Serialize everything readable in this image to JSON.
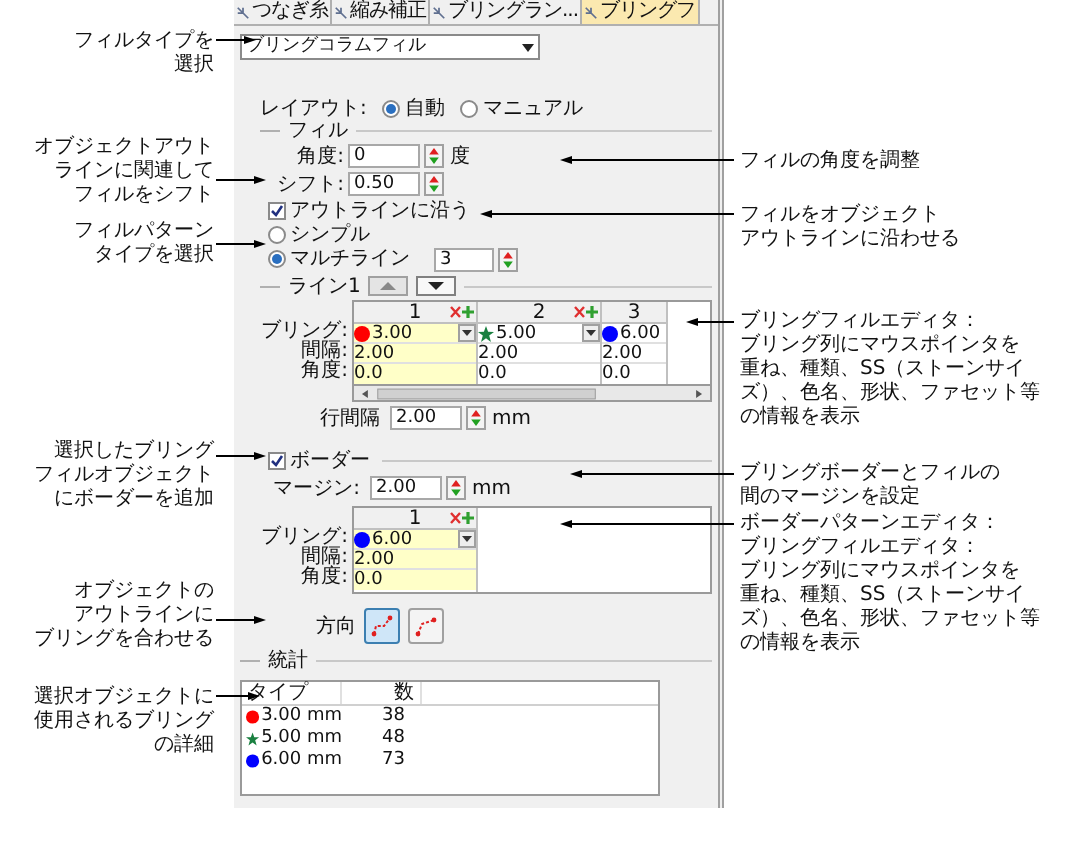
{
  "tabs": [
    {
      "label": "つなぎ糸",
      "selected": false
    },
    {
      "label": "縮み補正",
      "selected": false
    },
    {
      "label": "ブリングラン...",
      "selected": false
    },
    {
      "label": "ブリングフ",
      "selected": true
    }
  ],
  "fill_type": {
    "value": "ブリングコラムフィル"
  },
  "layout": {
    "label": "レイアウト:",
    "options": [
      {
        "label": "自動",
        "selected": true
      },
      {
        "label": "マニュアル",
        "selected": false
      }
    ]
  },
  "fill": {
    "title": "フィル",
    "angle": {
      "label": "角度:",
      "value": "0",
      "unit": "度"
    },
    "shift": {
      "label": "シフト:",
      "value": "0.50"
    },
    "follow_outline": {
      "label": "アウトラインに沿う",
      "checked": true
    },
    "pattern": [
      {
        "label": "シンプル",
        "selected": false
      },
      {
        "label": "マルチライン",
        "selected": true
      }
    ],
    "line_count": "3"
  },
  "line_editor": {
    "title": "ライン1",
    "row_labels": [
      "ブリング:",
      "間隔:",
      "角度:"
    ],
    "columns": [
      {
        "header": "1",
        "kind": "circle",
        "color": "#ff0000",
        "size": "3.00",
        "spacing": "2.00",
        "angle": "0.0",
        "selected": true
      },
      {
        "header": "2",
        "kind": "star",
        "color": "#1a8040",
        "size": "5.00",
        "spacing": "2.00",
        "angle": "0.0",
        "selected": false
      },
      {
        "header": "3",
        "kind": "circle",
        "color": "#0000ff",
        "size": "6.00",
        "spacing": "2.00",
        "angle": "0.0",
        "selected": false
      }
    ],
    "row_spacing": {
      "label": "行間隔",
      "value": "2.00",
      "unit": "mm"
    }
  },
  "border": {
    "label": "ボーダー",
    "checked": true,
    "margin": {
      "label": "マージン:",
      "value": "2.00",
      "unit": "mm"
    },
    "row_labels": [
      "ブリング:",
      "間隔:",
      "角度:"
    ],
    "columns": [
      {
        "header": "1",
        "kind": "circle",
        "color": "#0000ff",
        "size": "6.00",
        "spacing": "2.00",
        "angle": "0.0",
        "selected": true
      }
    ]
  },
  "direction": {
    "label": "方向",
    "options": [
      {
        "selected": true
      },
      {
        "selected": false
      }
    ]
  },
  "stats": {
    "title": "統計",
    "columns": [
      "タイプ",
      "数"
    ],
    "rows": [
      {
        "kind": "circle",
        "color": "#ff0000",
        "type": "3.00 mm",
        "count": "38"
      },
      {
        "kind": "star",
        "color": "#1a8040",
        "type": "5.00 mm",
        "count": "48"
      },
      {
        "kind": "circle",
        "color": "#0000ff",
        "type": "6.00 mm",
        "count": "73"
      }
    ]
  },
  "callouts_left": [
    {
      "lines": [
        "フィルタイプを",
        "選択"
      ]
    },
    {
      "lines": [
        "オブジェクトアウト",
        "ラインに関連して",
        "フィルをシフト"
      ]
    },
    {
      "lines": [
        "フィルパターン",
        "タイプを選択"
      ]
    },
    {
      "lines": [
        "選択したブリング",
        "フィルオブジェクト",
        "にボーダーを追加"
      ]
    },
    {
      "lines": [
        "オブジェクトの",
        "アウトラインに",
        "ブリングを合わせる"
      ]
    },
    {
      "lines": [
        "選択オブジェクトに",
        "使用されるブリング",
        "の詳細"
      ]
    }
  ],
  "callouts_right": [
    {
      "lines": [
        "フィルの角度を調整"
      ]
    },
    {
      "lines": [
        "フィルをオブジェクト",
        "アウトラインに沿わせる"
      ]
    },
    {
      "lines": [
        "ブリングフィルエディタ：",
        "ブリング列にマウスポインタを",
        "重ね、種類、SS（ストーンサイ",
        "ズ）、色名、形状、ファセット等",
        "の情報を表示"
      ]
    },
    {
      "lines": [
        "ブリングボーダーとフィルの",
        "間のマージンを設定"
      ]
    },
    {
      "lines": [
        "ボーダーパターンエディタ：",
        "ブリングフィルエディタ：",
        "ブリング列にマウスポインタを",
        "重ね、種類、SS（ストーンサイ",
        "ズ）、色名、形状、ファセット等",
        "の情報を表示"
      ]
    }
  ]
}
